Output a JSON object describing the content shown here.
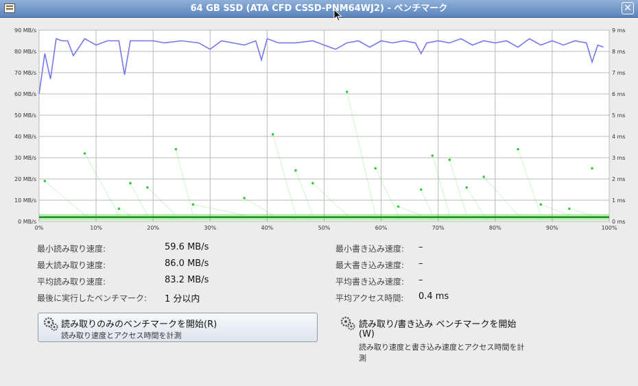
{
  "window": {
    "title": "64 GB SSD (ATA CFD CSSD-PNM64WJ2) - ベンチマーク"
  },
  "chart_data": {
    "type": "line",
    "left_axis": {
      "ticks": [
        "0 MB/s",
        "10 MB/s",
        "20 MB/s",
        "30 MB/s",
        "40 MB/s",
        "50 MB/s",
        "60 MB/s",
        "70 MB/s",
        "80 MB/s",
        "90 MB/s"
      ],
      "ylim": [
        0,
        90
      ],
      "unit": "MB/s"
    },
    "right_axis": {
      "ticks": [
        "0 ms",
        "1 ms",
        "2 ms",
        "3 ms",
        "4 ms",
        "5 ms",
        "6 ms",
        "7 ms",
        "8 ms",
        "9 ms"
      ],
      "ylim": [
        0,
        9
      ],
      "unit": "ms"
    },
    "x_axis": {
      "ticks": [
        "0%",
        "10%",
        "20%",
        "30%",
        "40%",
        "50%",
        "60%",
        "70%",
        "80%",
        "90%",
        "100%"
      ],
      "xlim": [
        0,
        100
      ]
    },
    "grid": true,
    "series": [
      {
        "color": "#7575ee",
        "kind": "read-rate",
        "x": [
          0,
          1,
          2,
          3,
          4,
          5,
          6,
          8,
          10,
          12,
          14,
          15,
          16,
          18,
          20,
          22,
          25,
          28,
          30,
          32,
          34,
          36,
          38,
          39,
          40,
          42,
          45,
          48,
          50,
          52,
          54,
          56,
          58,
          60,
          62,
          64,
          66,
          67,
          68,
          70,
          72,
          74,
          76,
          78,
          80,
          82,
          84,
          86,
          88,
          90,
          92,
          94,
          96,
          97,
          98,
          99
        ],
        "y": [
          60,
          79,
          67,
          86,
          85,
          85,
          78,
          86,
          83,
          85,
          85,
          69,
          85,
          85,
          85,
          84,
          85,
          84,
          81,
          85,
          84,
          83,
          85,
          76,
          86,
          84,
          84,
          85,
          83,
          81,
          84,
          85,
          82,
          85,
          84,
          85,
          84,
          79,
          84,
          85,
          84,
          86,
          83,
          85,
          84,
          85,
          82,
          86,
          83,
          85,
          83,
          85,
          84,
          75,
          83,
          82
        ]
      },
      {
        "color": "#33cc33",
        "kind": "access-time",
        "x": [
          1,
          8,
          14,
          16,
          19,
          24,
          27,
          36,
          41,
          45,
          48,
          54,
          59,
          63,
          67,
          69,
          72,
          75,
          78,
          84,
          88,
          93,
          97
        ],
        "y": [
          1.9,
          3.2,
          0.6,
          1.8,
          1.6,
          3.4,
          0.8,
          1.1,
          4.1,
          2.4,
          1.8,
          6.1,
          2.5,
          0.7,
          1.5,
          3.1,
          2.9,
          1.6,
          2.1,
          3.4,
          0.8,
          0.6,
          2.5
        ]
      }
    ]
  },
  "stats": {
    "min_read_label": "最小読み取り速度:",
    "min_read_value": "59.6 MB/s",
    "max_read_label": "最大読み取り速度:",
    "max_read_value": "86.0 MB/s",
    "avg_read_label": "平均読み取り速度:",
    "avg_read_value": "83.2 MB/s",
    "last_label": "最後に実行したベンチマーク:",
    "last_value": "1 分以内",
    "min_write_label": "最小書き込み速度:",
    "min_write_value": "–",
    "max_write_label": "最大書き込み速度:",
    "max_write_value": "–",
    "avg_write_label": "平均書き込み速度:",
    "avg_write_value": "–",
    "avg_access_label": "平均アクセス時間:",
    "avg_access_value": "0.4 ms"
  },
  "buttons": {
    "read_only_title": "読み取りのみのベンチマークを開始(R)",
    "read_only_sub": "読み取り速度とアクセス時間を計測",
    "read_write_title_1": "読み取り/書き込み ベンチマークを開始",
    "read_write_title_2": "(W)",
    "read_write_sub_1": "読み取り速度と書き込み速度とアクセス時間を計",
    "read_write_sub_2": "測"
  },
  "icons": {
    "window": "window-menu-icon",
    "close": "close-icon",
    "gear": "gear-icon",
    "cursor": "mouse-pointer-icon"
  }
}
